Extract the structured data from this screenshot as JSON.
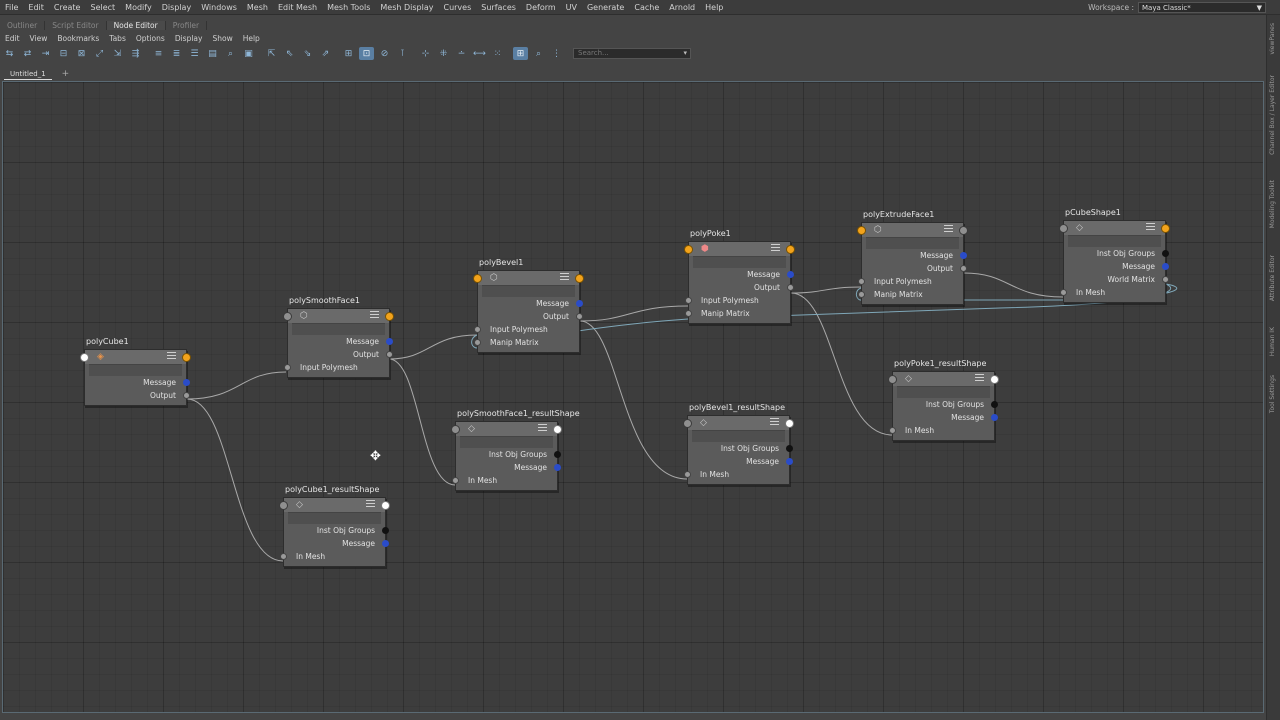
{
  "menubar": {
    "items": [
      "File",
      "Edit",
      "Create",
      "Select",
      "Modify",
      "Display",
      "Windows",
      "Mesh",
      "Edit Mesh",
      "Mesh Tools",
      "Mesh Display",
      "Curves",
      "Surfaces",
      "Deform",
      "UV",
      "Generate",
      "Cache",
      "Arnold",
      "Help"
    ],
    "workspace_label": "Workspace :",
    "workspace_value": "Maya Classic*"
  },
  "panel_tabs": [
    "Outliner",
    "Script Editor",
    "Node Editor",
    "Profiler"
  ],
  "editor_menu": [
    "Edit",
    "View",
    "Bookmarks",
    "Tabs",
    "Options",
    "Display",
    "Show",
    "Help"
  ],
  "toolbar": {
    "search_placeholder": "Search..."
  },
  "doc_tab": "Untitled_1",
  "doc_tab_add": "+",
  "side_tabs": [
    "viewPanes",
    "Channel Box / Layer Editor",
    "Modeling Toolkit",
    "Attribute Editor",
    "Human IK",
    "Tool Settings"
  ],
  "nodes": {
    "polyCube1": {
      "title": "polyCube1",
      "rows": [
        "Message",
        "Output"
      ]
    },
    "polySmoothFace1": {
      "title": "polySmoothFace1",
      "rows": [
        "Message",
        "Output",
        "Input Polymesh"
      ]
    },
    "polyBevel1": {
      "title": "polyBevel1",
      "rows": [
        "Message",
        "Output",
        "Input Polymesh",
        "Manip Matrix"
      ]
    },
    "polyPoke1": {
      "title": "polyPoke1",
      "rows": [
        "Message",
        "Output",
        "Input Polymesh",
        "Manip Matrix"
      ]
    },
    "polyExtrudeFace1": {
      "title": "polyExtrudeFace1",
      "rows": [
        "Message",
        "Output",
        "Input Polymesh",
        "Manip Matrix"
      ]
    },
    "pCubeShape1": {
      "title": "pCubeShape1",
      "rows": [
        "Inst Obj Groups",
        "Message",
        "World Matrix",
        "In Mesh"
      ]
    },
    "polyCube1_resultShape": {
      "title": "polyCube1_resultShape",
      "rows": [
        "Inst Obj Groups",
        "Message",
        "In Mesh"
      ]
    },
    "polySmoothFace1_resultShape": {
      "title": "polySmoothFace1_resultShape",
      "rows": [
        "Inst Obj Groups",
        "Message",
        "In Mesh"
      ]
    },
    "polyBevel1_resultShape": {
      "title": "polyBevel1_resultShape",
      "rows": [
        "Inst Obj Groups",
        "Message",
        "In Mesh"
      ]
    },
    "polyPoke1_resultShape": {
      "title": "polyPoke1_resultShape",
      "rows": [
        "Inst Obj Groups",
        "Message",
        "In Mesh"
      ]
    }
  },
  "colors": {
    "accent": "#5a7fa3",
    "port_orange": "#f2a31c",
    "port_blue": "#2a4cc9",
    "wire": "#a9a9a9",
    "wire_matrix": "#7fa7b8"
  },
  "icons": [
    "cube-icon",
    "poly-op-icon",
    "shape-icon",
    "node-menu-icon",
    "move-cursor-icon"
  ]
}
